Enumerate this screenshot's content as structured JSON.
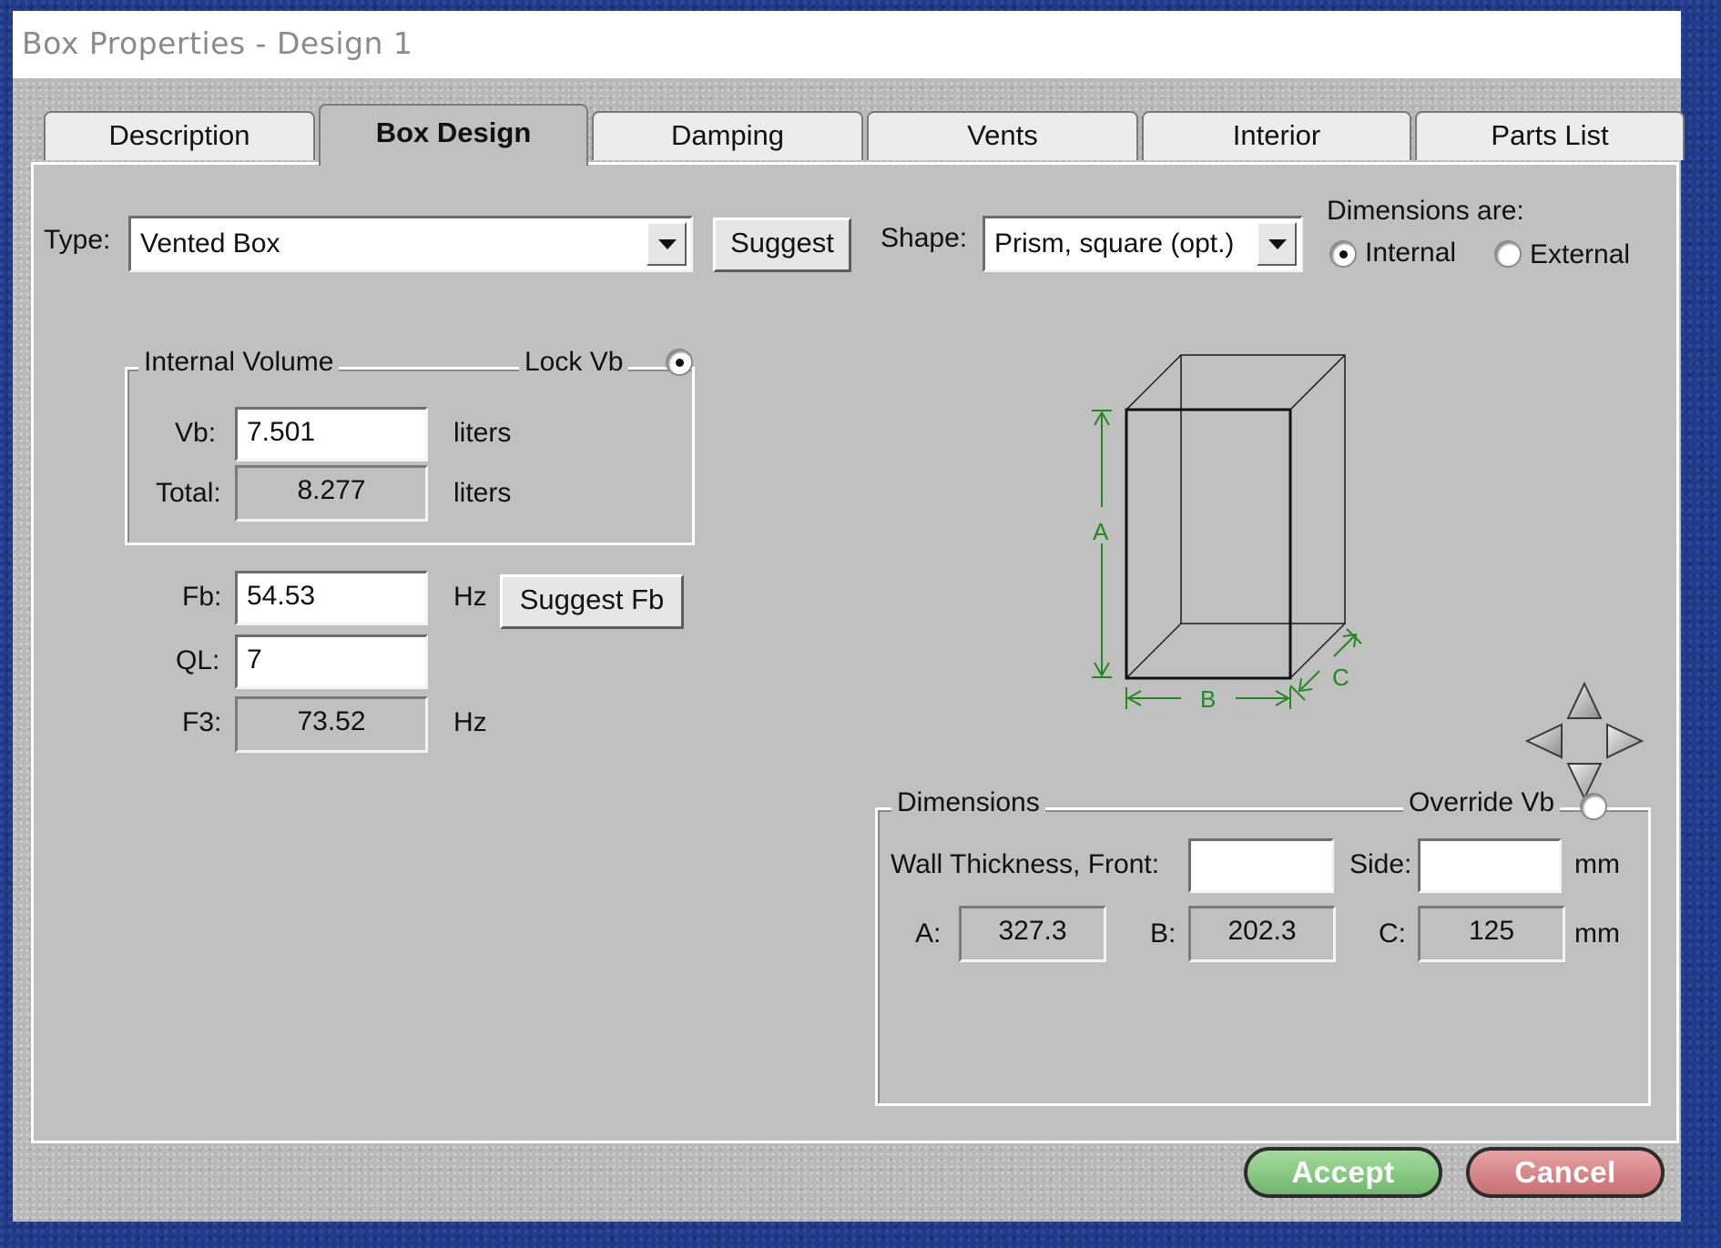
{
  "window": {
    "title": "Box Properties - Design 1"
  },
  "tabs": [
    {
      "label": "Description",
      "active": false
    },
    {
      "label": "Box Design",
      "active": true
    },
    {
      "label": "Damping",
      "active": false
    },
    {
      "label": "Vents",
      "active": false
    },
    {
      "label": "Interior",
      "active": false
    },
    {
      "label": "Parts List",
      "active": false
    }
  ],
  "type": {
    "label": "Type:",
    "value": "Vented Box",
    "suggest_label": "Suggest"
  },
  "shape": {
    "label": "Shape:",
    "value": "Prism, square (opt.)"
  },
  "dimensions_are": {
    "label": "Dimensions are:",
    "internal_label": "Internal",
    "external_label": "External",
    "selected": "Internal"
  },
  "internal_volume": {
    "legend": "Internal Volume",
    "lock_label": "Lock Vb",
    "lock_checked": true,
    "vb_label": "Vb:",
    "vb_value": "7.501",
    "vb_unit": "liters",
    "total_label": "Total:",
    "total_value": "8.277",
    "total_unit": "liters"
  },
  "tuning": {
    "fb_label": "Fb:",
    "fb_value": "54.53",
    "fb_unit": "Hz",
    "suggest_fb_label": "Suggest Fb",
    "ql_label": "QL:",
    "ql_value": "7",
    "f3_label": "F3:",
    "f3_value": "73.52",
    "f3_unit": "Hz"
  },
  "diagram": {
    "a_label": "A",
    "b_label": "B",
    "c_label": "C",
    "dim_color": "#1e8a1e"
  },
  "dimensions": {
    "legend": "Dimensions",
    "override_label": "Override Vb",
    "override_checked": false,
    "wall_front_label": "Wall Thickness, Front:",
    "wall_front_value": "",
    "side_label": "Side:",
    "side_value": "",
    "unit": "mm",
    "a_label": "A:",
    "a_value": "327.3",
    "b_label": "B:",
    "b_value": "202.3",
    "c_label": "C:",
    "c_value": "125",
    "unit2": "mm"
  },
  "footer": {
    "accept_label": "Accept",
    "cancel_label": "Cancel"
  },
  "colors": {
    "accept": "#7cc377",
    "cancel": "#d27f82",
    "desktop": "#1f3a8a"
  }
}
